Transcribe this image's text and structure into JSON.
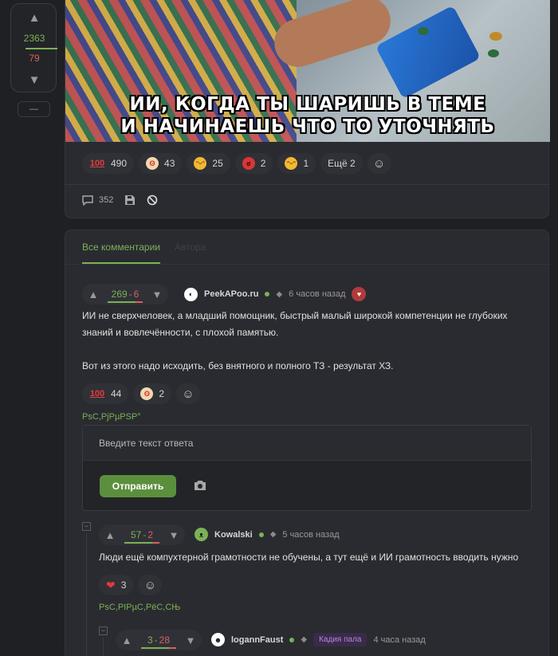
{
  "rail": {
    "up_icon": "chevron-up-icon",
    "plus": "2363",
    "minus": "79",
    "down_icon": "chevron-down-icon",
    "collapse": "—"
  },
  "post": {
    "image_caption_line1": "ИИ, КОГДА ТЫ ШАРИШЬ В ТЕМЕ",
    "image_caption_line2": "И НАЧИНАЕШЬ ЧТО ТО УТОЧНЯТЬ",
    "reactions": [
      {
        "icon": "hundred-icon",
        "glyph": "100",
        "count": "490"
      },
      {
        "icon": "clown-icon",
        "glyph": "ʘ",
        "count": "43"
      },
      {
        "icon": "laughing-icon",
        "glyph": "ᵔᵕᵔ",
        "count": "25"
      },
      {
        "icon": "angry-icon",
        "glyph": "ಠ",
        "count": "2"
      },
      {
        "icon": "sweat-smile-icon",
        "glyph": "ᵔᵕᵔ",
        "count": "1"
      }
    ],
    "more_reactions": "Ещё 2",
    "comments_count": "352"
  },
  "comments": {
    "tabs": [
      "Все комментарии",
      "Автора"
    ],
    "c1": {
      "plus": "269",
      "minus": "6",
      "author": "PeekAPoo.ru",
      "time": "6 часов назад",
      "text_p1": "ИИ не сверхчеловек, а младший помощник, быстрый малый широкой компетенции не глубоких знаний и вовлечённости, с плохой памятью.",
      "text_p2": "Вот из этого надо исходить, без внятного и полного ТЗ - результат ХЗ.",
      "reactions": [
        {
          "icon": "hundred-icon",
          "glyph": "100",
          "count": "44"
        },
        {
          "icon": "clown-icon",
          "glyph": "ʘ",
          "count": "2"
        }
      ],
      "glitch": "PsC,PjPµPSP°"
    },
    "reply": {
      "placeholder": "Введите текст ответа",
      "send": "Отправить"
    },
    "c2": {
      "plus": "57",
      "minus": "2",
      "author": "Kowalski",
      "time": "5 часов назад",
      "text": "Люди ещё компухтерной грамотности не обучены, а тут ещё и ИИ грамотность вводить нужно",
      "reactions": [
        {
          "icon": "heart-icon",
          "glyph": "❤",
          "count": "3"
        }
      ],
      "glitch": "PsC,PIPµC,PёC,CЊ"
    },
    "c3": {
      "plus": "3",
      "minus": "28",
      "author": "logannFaust",
      "badge": "Кадия пала",
      "time": "4 часа назад"
    }
  },
  "colors": {
    "accent": "#7bb157",
    "negative": "#d66060",
    "background": "#1f2024",
    "card": "#2a2b30"
  }
}
